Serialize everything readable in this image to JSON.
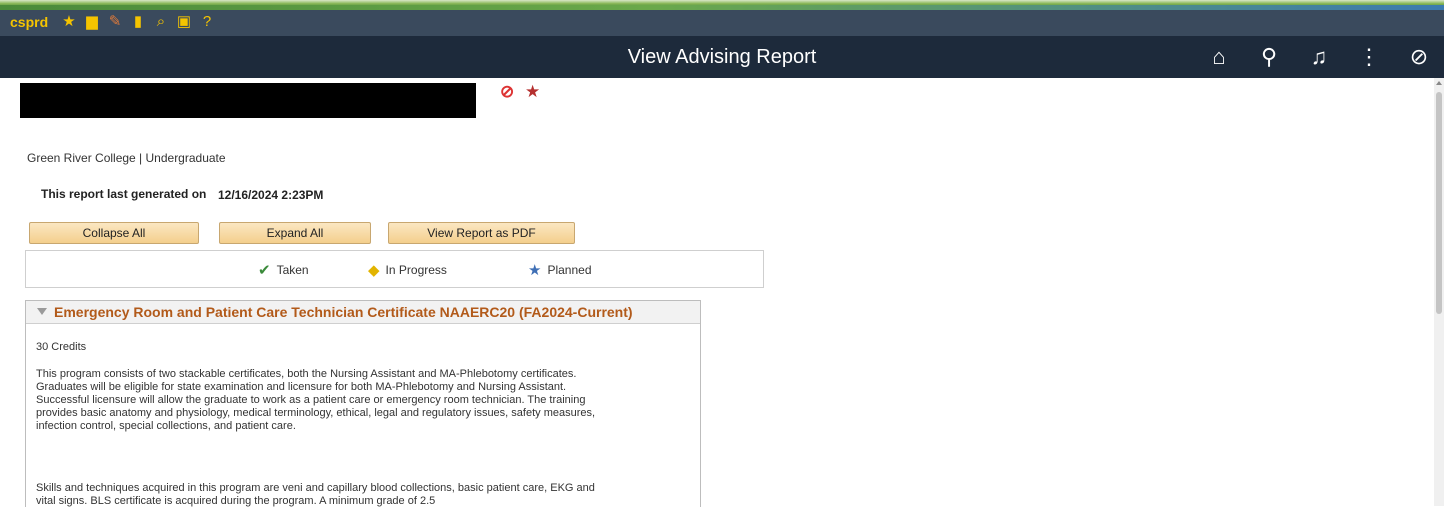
{
  "toolbar": {
    "env_label": "csprd",
    "icons": [
      "star-icon",
      "folder-icon",
      "pencil-icon",
      "document-icon",
      "search-icon",
      "tool-icon",
      "help-icon"
    ]
  },
  "header": {
    "title": "View Advising Report",
    "icons": [
      "home-icon",
      "search-icon",
      "bell-icon",
      "more-vertical-icon",
      "compass-icon"
    ]
  },
  "student": {
    "org": "Green River College | Undergraduate",
    "generated_label": "This report last generated on",
    "generated_value": "12/16/2024  2:23PM"
  },
  "buttons": {
    "collapse_all": "Collapse All",
    "expand_all": "Expand All",
    "view_pdf": "View Report as PDF"
  },
  "legend": {
    "taken": "Taken",
    "in_progress": "In Progress",
    "planned": "Planned"
  },
  "program": {
    "title": "Emergency Room and Patient Care Technician Certificate NAAERC20 (FA2024-Current)",
    "credits": "30 Credits",
    "paragraph1": "This program consists of two stackable certificates, both the Nursing Assistant and MA-Phlebotomy certificates. Graduates will be eligible for state examination and licensure for both MA-Phlebotomy and Nursing Assistant. Successful licensure will allow the graduate to work as a patient care or emergency room technician. The training provides basic anatomy and physiology, medical terminology, ethical, legal and regulatory issues, safety measures, infection control, special collections, and patient care.",
    "paragraph2": "Skills and techniques acquired in this program are veni and capillary blood collections, basic patient care, EKG and vital signs. BLS certificate is acquired during the program. A minimum grade of 2.5"
  },
  "colors": {
    "header_bg": "#1d2a3b",
    "toolbar_bg": "#3a4a5d",
    "env_yellow": "#f5c400",
    "title_orange": "#b25a1a",
    "taken_green": "#3a8a3a",
    "in_progress_yellow": "#e2b400",
    "planned_blue": "#3f6fb5"
  }
}
